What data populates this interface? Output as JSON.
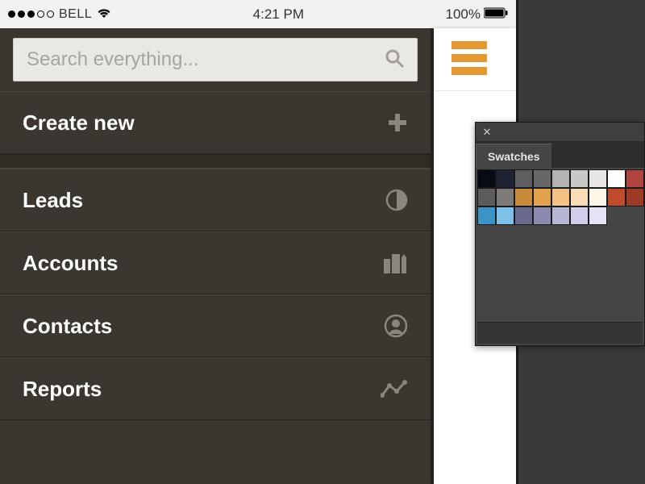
{
  "statusbar": {
    "carrier": "BELL",
    "time": "4:21 PM",
    "battery": "100%"
  },
  "search": {
    "placeholder": "Search everything..."
  },
  "menu": {
    "create": "Create new",
    "leads": "Leads",
    "accounts": "Accounts",
    "contacts": "Contacts",
    "reports": "Reports"
  },
  "swatches": {
    "tab": "Swatches",
    "colors": [
      "#070b13",
      "#1e2433",
      "#5e5d62",
      "#67676a",
      "#b3b3b2",
      "#c9c8c6",
      "#e8e7e5",
      "#fefefe",
      "#b14340",
      "#5e5c5a",
      "#7d7a77",
      "#c78b3b",
      "#e2a24c",
      "#f3c183",
      "#f8dcb6",
      "#fff6ea",
      "#c04a2c",
      "#9e3b26",
      "#3a94c5",
      "#7dc1e8",
      "#6a6a8e",
      "#8b8bb0",
      "#b7b6d4",
      "#d0ceea",
      "#e4e2f5"
    ]
  }
}
